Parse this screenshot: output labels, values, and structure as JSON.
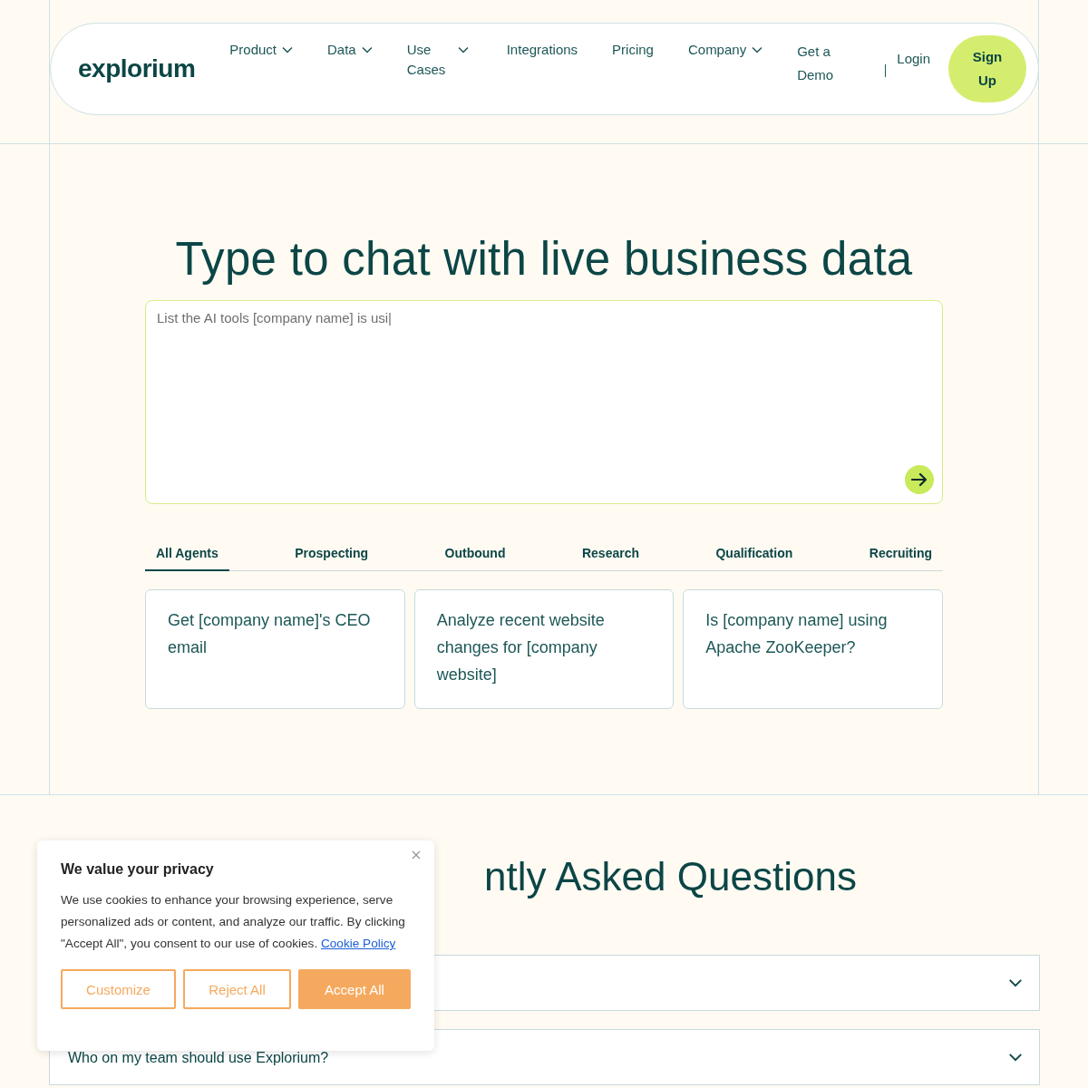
{
  "nav": {
    "logo": "explorium",
    "items": [
      {
        "label": "Product",
        "kind": "dropdown"
      },
      {
        "label": "Data",
        "kind": "dropdown"
      },
      {
        "label": "Use Cases",
        "kind": "dropdown"
      },
      {
        "label": "Integrations",
        "kind": "link"
      },
      {
        "label": "Pricing",
        "kind": "link"
      },
      {
        "label": "Company",
        "kind": "dropdown"
      },
      {
        "label": "Get a Demo",
        "kind": "link"
      }
    ],
    "login": "Login",
    "signup": "Sign Up"
  },
  "hero": {
    "title": "Type to chat with live business data",
    "prompt": "List the AI tools [company name] is usi|",
    "tabs": [
      {
        "label": "All Agents",
        "selected": true
      },
      {
        "label": "Prospecting",
        "selected": false
      },
      {
        "label": "Outbound",
        "selected": false
      },
      {
        "label": "Research",
        "selected": false
      },
      {
        "label": "Qualification",
        "selected": false
      },
      {
        "label": "Recruiting",
        "selected": false
      }
    ],
    "cards": [
      "Get [company name]'s CEO email",
      "Analyze recent website changes for [company website]",
      "Is [company name] using Apache ZooKeeper?"
    ]
  },
  "faq": {
    "title": "ntly Asked Questions",
    "questions": [
      {
        "expanded": false
      },
      {
        "question": "Who on my team should use Explorium?",
        "expanded": false
      }
    ]
  },
  "cookie": {
    "title": "We value your privacy",
    "text": "We use cookies to enhance your browsing experience, serve personalized ads or content, and analyze our traffic. By clicking \"Accept All\", you consent to our use of cookies.",
    "link": "Cookie Policy",
    "buttons": [
      {
        "label": "Customize",
        "kind": "outline"
      },
      {
        "label": "Reject All",
        "kind": "outline"
      },
      {
        "label": "Accept All",
        "kind": "filled"
      }
    ]
  }
}
